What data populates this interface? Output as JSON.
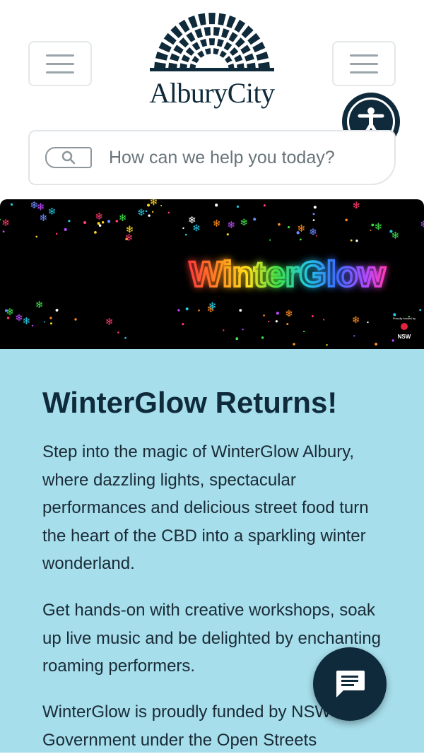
{
  "header": {
    "menu_left_label": "Open menu",
    "menu_right_label": "Open menu",
    "logo_text": "AlburyCity",
    "accessibility_label": "Accessibility options"
  },
  "search": {
    "placeholder": "How can we help you today?",
    "icon": "search-icon"
  },
  "banner": {
    "title": "WinterGlow",
    "sponsor_caption": "Proudly funded by",
    "sponsor": "NSW"
  },
  "article": {
    "heading": "WinterGlow Returns!",
    "paragraphs": [
      "Step into the magic of WinterGlow Albury, where dazzling lights, spectacular performances and delicious street food turn the heart of the CBD into a sparkling winter wonderland.",
      "Get hands-on with creative workshops, soak up live music and be delighted by enchanting roaming performers.",
      "WinterGlow is proudly funded by NSW Government under the Open Streets"
    ]
  },
  "chat": {
    "label": "Open chat",
    "icon": "chat-icon"
  },
  "colors": {
    "brand_navy": "#0f2a3a",
    "content_bg": "#a6deeb",
    "banner_bg": "#000000"
  }
}
